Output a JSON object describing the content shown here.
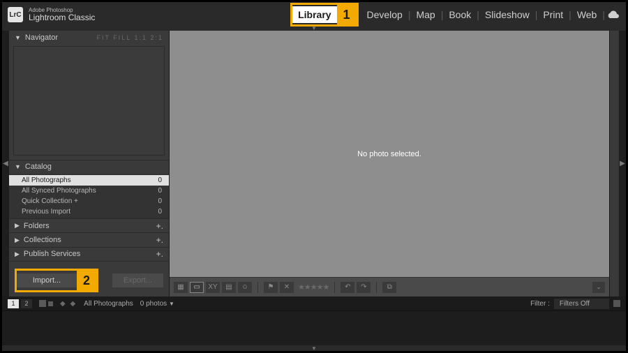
{
  "header": {
    "logo_text": "LrC",
    "subtitle": "Adobe Photoshop",
    "title": "Lightroom Classic"
  },
  "modules": {
    "items": [
      "Library",
      "Develop",
      "Map",
      "Book",
      "Slideshow",
      "Print",
      "Web"
    ],
    "active_index": 0
  },
  "callouts": {
    "one": "1",
    "two": "2"
  },
  "left_panel": {
    "navigator": {
      "label": "Navigator",
      "tail": "FIT  FILL  1:1  2:1"
    },
    "catalog": {
      "label": "Catalog",
      "items": [
        {
          "label": "All Photographs",
          "count": "0",
          "selected": true
        },
        {
          "label": "All Synced Photographs",
          "count": "0",
          "selected": false
        },
        {
          "label": "Quick Collection  +",
          "count": "0",
          "selected": false
        },
        {
          "label": "Previous Import",
          "count": "0",
          "selected": false
        }
      ]
    },
    "folders": {
      "label": "Folders"
    },
    "collections": {
      "label": "Collections"
    },
    "publish": {
      "label": "Publish Services"
    },
    "import_label": "Import...",
    "export_label": "Export..."
  },
  "center": {
    "empty_message": "No photo selected."
  },
  "bottom_bar": {
    "pages": [
      "1",
      "2"
    ],
    "active_page_index": 0,
    "breadcrumb": "All Photographs",
    "count_label": "0 photos",
    "filter_label": "Filter :",
    "filter_value": "Filters Off"
  }
}
